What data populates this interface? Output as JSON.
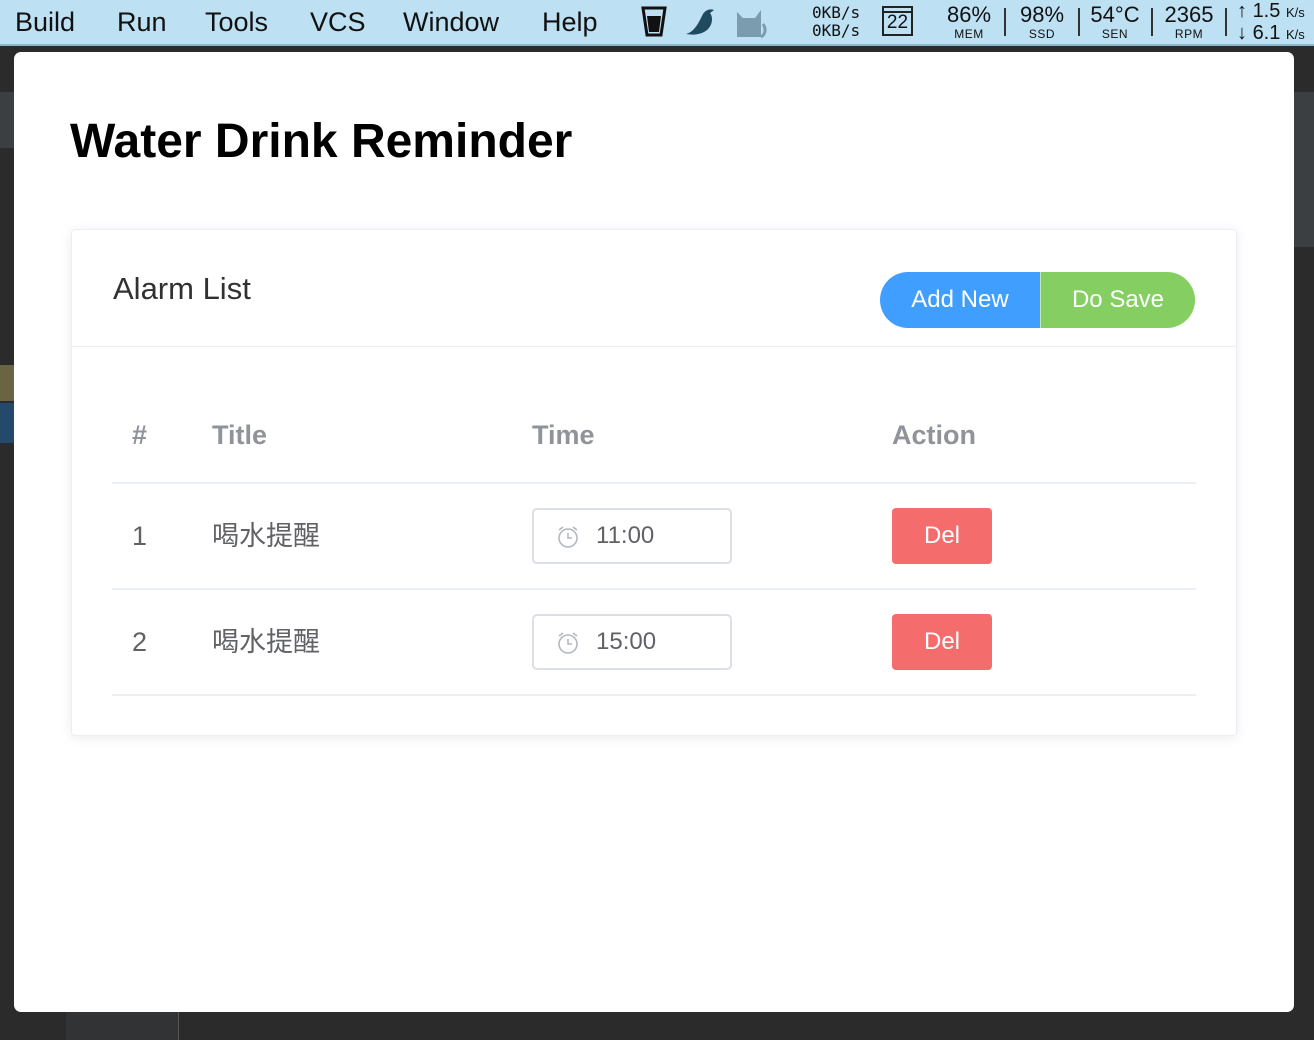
{
  "menubar": {
    "items": [
      "Build",
      "Run",
      "Tools",
      "VCS",
      "Window",
      "Help"
    ],
    "net": {
      "up": "0KB/s",
      "down": "0KB/s"
    },
    "calendar_day": "22",
    "stats": [
      {
        "value": "86%",
        "label": "MEM"
      },
      {
        "value": "98%",
        "label": "SSD"
      },
      {
        "value": "54°C",
        "label": "SEN"
      },
      {
        "value": "2365",
        "label": "RPM"
      }
    ],
    "speed": {
      "up": "1.5",
      "down": "6.1",
      "unit": "K/s"
    },
    "tray_icons": [
      "cup-icon",
      "bird-icon",
      "cat-icon"
    ]
  },
  "app": {
    "title": "Water Drink Reminder",
    "card_title": "Alarm List",
    "buttons": {
      "add": "Add New",
      "save": "Do Save"
    },
    "columns": [
      "#",
      "Title",
      "Time",
      "Action"
    ],
    "rows": [
      {
        "index": "1",
        "title": "喝水提醒",
        "time": "11:00",
        "action": "Del"
      },
      {
        "index": "2",
        "title": "喝水提醒",
        "time": "15:00",
        "action": "Del"
      }
    ]
  },
  "colors": {
    "primary": "#409eff",
    "success": "#85ce61",
    "danger": "#f56c6c",
    "menubar": "#bde0f3"
  }
}
